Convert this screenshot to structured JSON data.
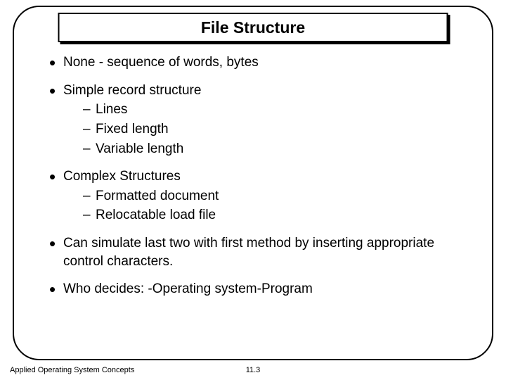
{
  "title": "File Structure",
  "bullets": {
    "b0": "None - sequence of words, bytes",
    "b1": "Simple record structure",
    "b1_subs": {
      "s0": "Lines",
      "s1": "Fixed length",
      "s2": "Variable length"
    },
    "b2": "Complex Structures",
    "b2_subs": {
      "s0": "Formatted document",
      "s1": "Relocatable load file"
    },
    "b3": "Can simulate last two with first method by inserting appropriate control characters.",
    "b4": "Who decides: -Operating system-Program"
  },
  "footer": {
    "left": "Applied Operating System Concepts",
    "center": "11.3"
  }
}
